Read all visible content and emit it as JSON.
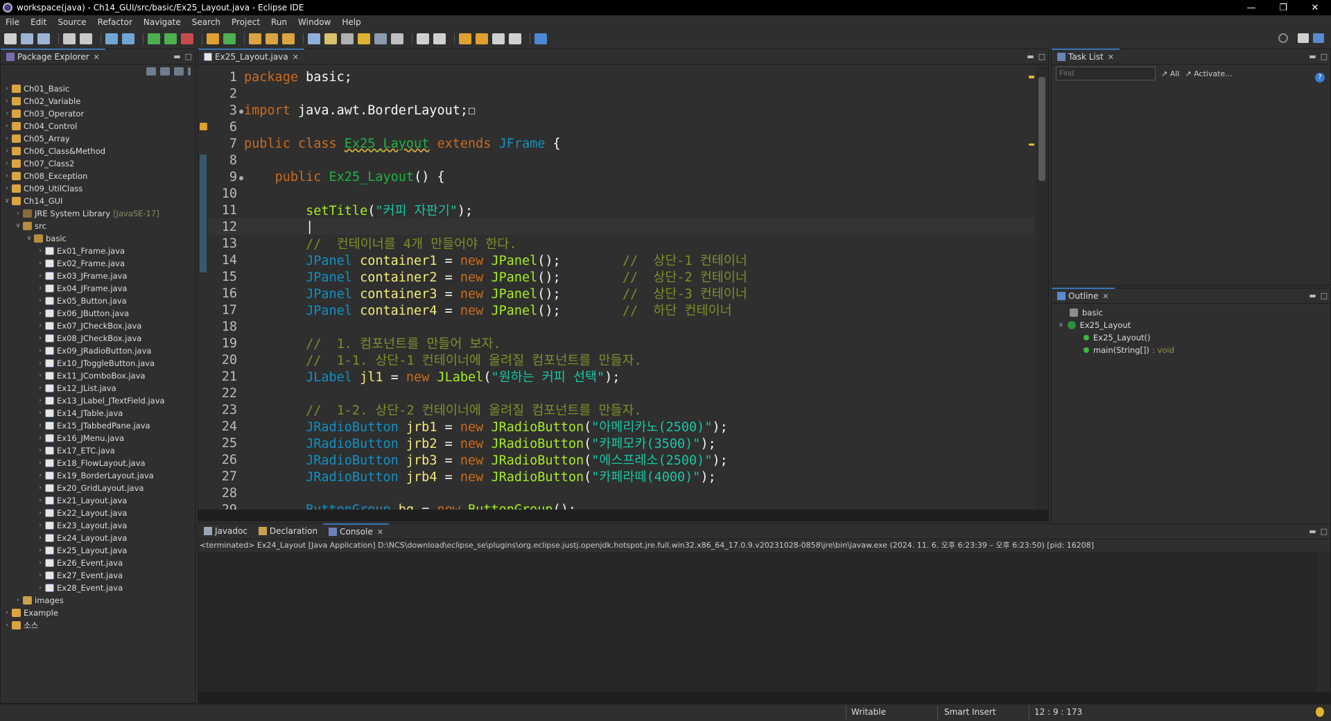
{
  "window": {
    "title": "workspace(java) - Ch14_GUI/src/basic/Ex25_Layout.java - Eclipse IDE"
  },
  "menu": [
    "File",
    "Edit",
    "Source",
    "Refactor",
    "Navigate",
    "Search",
    "Project",
    "Run",
    "Window",
    "Help"
  ],
  "package_explorer": {
    "tab": "Package Explorer",
    "items": [
      {
        "label": "Ch01_Basic",
        "depth": 0,
        "icon": "project-icon"
      },
      {
        "label": "Ch02_Variable",
        "depth": 0,
        "icon": "project-icon"
      },
      {
        "label": "Ch03_Operator",
        "depth": 0,
        "icon": "project-icon"
      },
      {
        "label": "Ch04_Control",
        "depth": 0,
        "icon": "project-icon"
      },
      {
        "label": "Ch05_Array",
        "depth": 0,
        "icon": "project-icon"
      },
      {
        "label": "Ch06_Class&Method",
        "depth": 0,
        "icon": "project-icon"
      },
      {
        "label": "Ch07_Class2",
        "depth": 0,
        "icon": "project-icon"
      },
      {
        "label": "Ch08_Exception",
        "depth": 0,
        "icon": "project-icon"
      },
      {
        "label": "Ch09_UtilClass",
        "depth": 0,
        "icon": "project-icon"
      },
      {
        "label": "Ch14_GUI",
        "depth": 0,
        "icon": "project-icon",
        "expanded": true
      },
      {
        "label": "JRE System Library",
        "suffix": "[JavaSE-17]",
        "depth": 1,
        "icon": "library-icon"
      },
      {
        "label": "src",
        "depth": 1,
        "icon": "source-folder-icon",
        "expanded": true
      },
      {
        "label": "basic",
        "depth": 2,
        "icon": "package-icon",
        "expanded": true
      },
      {
        "label": "Ex01_Frame.java",
        "depth": 3,
        "icon": "java-file-icon"
      },
      {
        "label": "Ex02_Frame.java",
        "depth": 3,
        "icon": "java-file-icon"
      },
      {
        "label": "Ex03_JFrame.java",
        "depth": 3,
        "icon": "java-file-icon"
      },
      {
        "label": "Ex04_JFrame.java",
        "depth": 3,
        "icon": "java-file-icon"
      },
      {
        "label": "Ex05_Button.java",
        "depth": 3,
        "icon": "java-file-icon"
      },
      {
        "label": "Ex06_JButton.java",
        "depth": 3,
        "icon": "java-file-icon"
      },
      {
        "label": "Ex07_JCheckBox.java",
        "depth": 3,
        "icon": "java-file-icon"
      },
      {
        "label": "Ex08_JCheckBox.java",
        "depth": 3,
        "icon": "java-file-icon"
      },
      {
        "label": "Ex09_JRadioButton.java",
        "depth": 3,
        "icon": "java-file-icon"
      },
      {
        "label": "Ex10_JToggleButton.java",
        "depth": 3,
        "icon": "java-file-icon"
      },
      {
        "label": "Ex11_JComboBox.java",
        "depth": 3,
        "icon": "java-file-icon"
      },
      {
        "label": "Ex12_JList.java",
        "depth": 3,
        "icon": "java-file-icon"
      },
      {
        "label": "Ex13_JLabel_JTextField.java",
        "depth": 3,
        "icon": "java-file-icon"
      },
      {
        "label": "Ex14_JTable.java",
        "depth": 3,
        "icon": "java-file-icon"
      },
      {
        "label": "Ex15_JTabbedPane.java",
        "depth": 3,
        "icon": "java-file-icon"
      },
      {
        "label": "Ex16_JMenu.java",
        "depth": 3,
        "icon": "java-file-icon"
      },
      {
        "label": "Ex17_ETC.java",
        "depth": 3,
        "icon": "java-file-icon"
      },
      {
        "label": "Ex18_FlowLayout.java",
        "depth": 3,
        "icon": "java-file-icon"
      },
      {
        "label": "Ex19_BorderLayout.java",
        "depth": 3,
        "icon": "java-file-icon"
      },
      {
        "label": "Ex20_GridLayout.java",
        "depth": 3,
        "icon": "java-file-icon"
      },
      {
        "label": "Ex21_Layout.java",
        "depth": 3,
        "icon": "java-file-icon"
      },
      {
        "label": "Ex22_Layout.java",
        "depth": 3,
        "icon": "java-file-icon"
      },
      {
        "label": "Ex23_Layout.java",
        "depth": 3,
        "icon": "java-file-icon"
      },
      {
        "label": "Ex24_Layout.java",
        "depth": 3,
        "icon": "java-file-icon"
      },
      {
        "label": "Ex25_Layout.java",
        "depth": 3,
        "icon": "java-file-icon"
      },
      {
        "label": "Ex26_Event.java",
        "depth": 3,
        "icon": "java-file-icon"
      },
      {
        "label": "Ex27_Event.java",
        "depth": 3,
        "icon": "java-file-icon"
      },
      {
        "label": "Ex28_Event.java",
        "depth": 3,
        "icon": "java-file-icon"
      },
      {
        "label": "images",
        "depth": 1,
        "icon": "folder-icon"
      },
      {
        "label": "Example",
        "depth": 0,
        "icon": "project-icon"
      },
      {
        "label": "소스",
        "depth": 0,
        "icon": "project-icon"
      }
    ]
  },
  "editor": {
    "tab": "Ex25_Layout.java",
    "lines": [
      {
        "n": "1",
        "tokens": [
          [
            "kw",
            "package"
          ],
          [
            "pl",
            " basic;"
          ]
        ]
      },
      {
        "n": "2",
        "tokens": []
      },
      {
        "n": "3",
        "fold": true,
        "tokens": [
          [
            "kw",
            "import"
          ],
          [
            "pl",
            " java.awt.BorderLayout;"
          ],
          [
            "pl",
            "☐"
          ]
        ]
      },
      {
        "n": "6",
        "tokens": []
      },
      {
        "n": "7",
        "tokens": [
          [
            "kw",
            "public class "
          ],
          [
            "cls und",
            "Ex25_Layout"
          ],
          [
            "kw",
            " extends "
          ],
          [
            "ty",
            "JFrame"
          ],
          [
            "pl",
            " {"
          ]
        ]
      },
      {
        "n": "8",
        "tokens": []
      },
      {
        "n": "9",
        "fold": true,
        "tokens": [
          [
            "pl",
            "    "
          ],
          [
            "kw",
            "public "
          ],
          [
            "cls",
            "Ex25_Layout"
          ],
          [
            "pl",
            "() {"
          ]
        ]
      },
      {
        "n": "10",
        "tokens": []
      },
      {
        "n": "11",
        "tokens": [
          [
            "pl",
            "        "
          ],
          [
            "fn",
            "setTitle"
          ],
          [
            "pl",
            "("
          ],
          [
            "str",
            "\"커피 자판기\""
          ],
          [
            "pl",
            ");"
          ]
        ]
      },
      {
        "n": "12",
        "tokens": [
          [
            "pl",
            "        |"
          ]
        ],
        "current": true
      },
      {
        "n": "13",
        "tokens": [
          [
            "pl",
            "        "
          ],
          [
            "cm",
            "//  컨테이너를 4개 만들어야 한다."
          ]
        ]
      },
      {
        "n": "14",
        "tokens": [
          [
            "pl",
            "        "
          ],
          [
            "ty",
            "JPanel"
          ],
          [
            "pl",
            " "
          ],
          [
            "vr",
            "container1"
          ],
          [
            "pl",
            " = "
          ],
          [
            "kw",
            "new"
          ],
          [
            "pl",
            " "
          ],
          [
            "mt",
            "JPanel"
          ],
          [
            "pl",
            "();        "
          ],
          [
            "cm",
            "//  상단-1 컨테이너"
          ]
        ]
      },
      {
        "n": "15",
        "tokens": [
          [
            "pl",
            "        "
          ],
          [
            "ty",
            "JPanel"
          ],
          [
            "pl",
            " "
          ],
          [
            "vr",
            "container2"
          ],
          [
            "pl",
            " = "
          ],
          [
            "kw",
            "new"
          ],
          [
            "pl",
            " "
          ],
          [
            "mt",
            "JPanel"
          ],
          [
            "pl",
            "();        "
          ],
          [
            "cm",
            "//  상단-2 컨테이너"
          ]
        ]
      },
      {
        "n": "16",
        "tokens": [
          [
            "pl",
            "        "
          ],
          [
            "ty",
            "JPanel"
          ],
          [
            "pl",
            " "
          ],
          [
            "vr",
            "container3"
          ],
          [
            "pl",
            " = "
          ],
          [
            "kw",
            "new"
          ],
          [
            "pl",
            " "
          ],
          [
            "mt",
            "JPanel"
          ],
          [
            "pl",
            "();        "
          ],
          [
            "cm",
            "//  상단-3 컨테이너"
          ]
        ]
      },
      {
        "n": "17",
        "tokens": [
          [
            "pl",
            "        "
          ],
          [
            "ty",
            "JPanel"
          ],
          [
            "pl",
            " "
          ],
          [
            "vr",
            "container4"
          ],
          [
            "pl",
            " = "
          ],
          [
            "kw",
            "new"
          ],
          [
            "pl",
            " "
          ],
          [
            "mt",
            "JPanel"
          ],
          [
            "pl",
            "();        "
          ],
          [
            "cm",
            "//  하단 컨테이너"
          ]
        ]
      },
      {
        "n": "18",
        "tokens": []
      },
      {
        "n": "19",
        "tokens": [
          [
            "pl",
            "        "
          ],
          [
            "cm",
            "//  1. 컴포넌트를 만들어 보자."
          ]
        ]
      },
      {
        "n": "20",
        "tokens": [
          [
            "pl",
            "        "
          ],
          [
            "cm",
            "//  1-1. 상단-1 컨테이너에 올려질 컴포넌트를 만들자."
          ]
        ]
      },
      {
        "n": "21",
        "tokens": [
          [
            "pl",
            "        "
          ],
          [
            "ty",
            "JLabel"
          ],
          [
            "pl",
            " "
          ],
          [
            "vr",
            "jl1"
          ],
          [
            "pl",
            " = "
          ],
          [
            "kw",
            "new"
          ],
          [
            "pl",
            " "
          ],
          [
            "mt",
            "JLabel"
          ],
          [
            "pl",
            "("
          ],
          [
            "str",
            "\"원하는 커피 선택\""
          ],
          [
            "pl",
            ");"
          ]
        ]
      },
      {
        "n": "22",
        "tokens": []
      },
      {
        "n": "23",
        "tokens": [
          [
            "pl",
            "        "
          ],
          [
            "cm",
            "//  1-2. 상단-2 컨테이너에 올려질 컴포넌트를 만들자."
          ]
        ]
      },
      {
        "n": "24",
        "tokens": [
          [
            "pl",
            "        "
          ],
          [
            "ty",
            "JRadioButton"
          ],
          [
            "pl",
            " "
          ],
          [
            "vr",
            "jrb1"
          ],
          [
            "pl",
            " = "
          ],
          [
            "kw",
            "new"
          ],
          [
            "pl",
            " "
          ],
          [
            "mt",
            "JRadioButton"
          ],
          [
            "pl",
            "("
          ],
          [
            "str",
            "\"아메리카노(2500)\""
          ],
          [
            "pl",
            ");"
          ]
        ]
      },
      {
        "n": "25",
        "tokens": [
          [
            "pl",
            "        "
          ],
          [
            "ty",
            "JRadioButton"
          ],
          [
            "pl",
            " "
          ],
          [
            "vr",
            "jrb2"
          ],
          [
            "pl",
            " = "
          ],
          [
            "kw",
            "new"
          ],
          [
            "pl",
            " "
          ],
          [
            "mt",
            "JRadioButton"
          ],
          [
            "pl",
            "("
          ],
          [
            "str",
            "\"카페모카(3500)\""
          ],
          [
            "pl",
            ");"
          ]
        ]
      },
      {
        "n": "26",
        "tokens": [
          [
            "pl",
            "        "
          ],
          [
            "ty",
            "JRadioButton"
          ],
          [
            "pl",
            " "
          ],
          [
            "vr",
            "jrb3"
          ],
          [
            "pl",
            " = "
          ],
          [
            "kw",
            "new"
          ],
          [
            "pl",
            " "
          ],
          [
            "mt",
            "JRadioButton"
          ],
          [
            "pl",
            "("
          ],
          [
            "str",
            "\"에스프레소(2500)\""
          ],
          [
            "pl",
            ");"
          ]
        ]
      },
      {
        "n": "27",
        "tokens": [
          [
            "pl",
            "        "
          ],
          [
            "ty",
            "JRadioButton"
          ],
          [
            "pl",
            " "
          ],
          [
            "vr",
            "jrb4"
          ],
          [
            "pl",
            " = "
          ],
          [
            "kw",
            "new"
          ],
          [
            "pl",
            " "
          ],
          [
            "mt",
            "JRadioButton"
          ],
          [
            "pl",
            "("
          ],
          [
            "str",
            "\"카페라떼(4000)\""
          ],
          [
            "pl",
            ");"
          ]
        ]
      },
      {
        "n": "28",
        "tokens": []
      },
      {
        "n": "29",
        "tokens": [
          [
            "pl",
            "        "
          ],
          [
            "ty",
            "ButtonGroup"
          ],
          [
            "pl",
            " "
          ],
          [
            "vr",
            "bg"
          ],
          [
            "pl",
            " = "
          ],
          [
            "kw",
            "new"
          ],
          [
            "pl",
            " "
          ],
          [
            "mt",
            "ButtonGroup"
          ],
          [
            "pl",
            "();"
          ]
        ]
      }
    ]
  },
  "task_list": {
    "tab": "Task List",
    "find_placeholder": "Find",
    "all_label": "All",
    "activate_label": "Activate..."
  },
  "outline": {
    "tab": "Outline",
    "items": [
      {
        "label": "basic",
        "suffix": "",
        "kind": "pkg"
      },
      {
        "label": "Ex25_Layout",
        "suffix": "",
        "kind": "class"
      },
      {
        "label": "Ex25_Layout()",
        "suffix": "",
        "kind": "method"
      },
      {
        "label": "main(String[])",
        "suffix": ": void",
        "kind": "method"
      }
    ]
  },
  "console": {
    "tabs": [
      "Javadoc",
      "Declaration",
      "Console"
    ],
    "terminated": "<terminated> Ex24_Layout [Java Application] D:\\NCS\\download\\eclipse_se\\plugins\\org.eclipse.justj.openjdk.hotspot.jre.full.win32.x86_64_17.0.9.v20231028-0858\\jre\\bin\\javaw.exe  (2024. 11. 6. 오후 6:23:39 – 오후 6:23:50) [pid: 16208]"
  },
  "status": {
    "writable": "Writable",
    "insert": "Smart Insert",
    "position": "12 : 9 : 173"
  }
}
